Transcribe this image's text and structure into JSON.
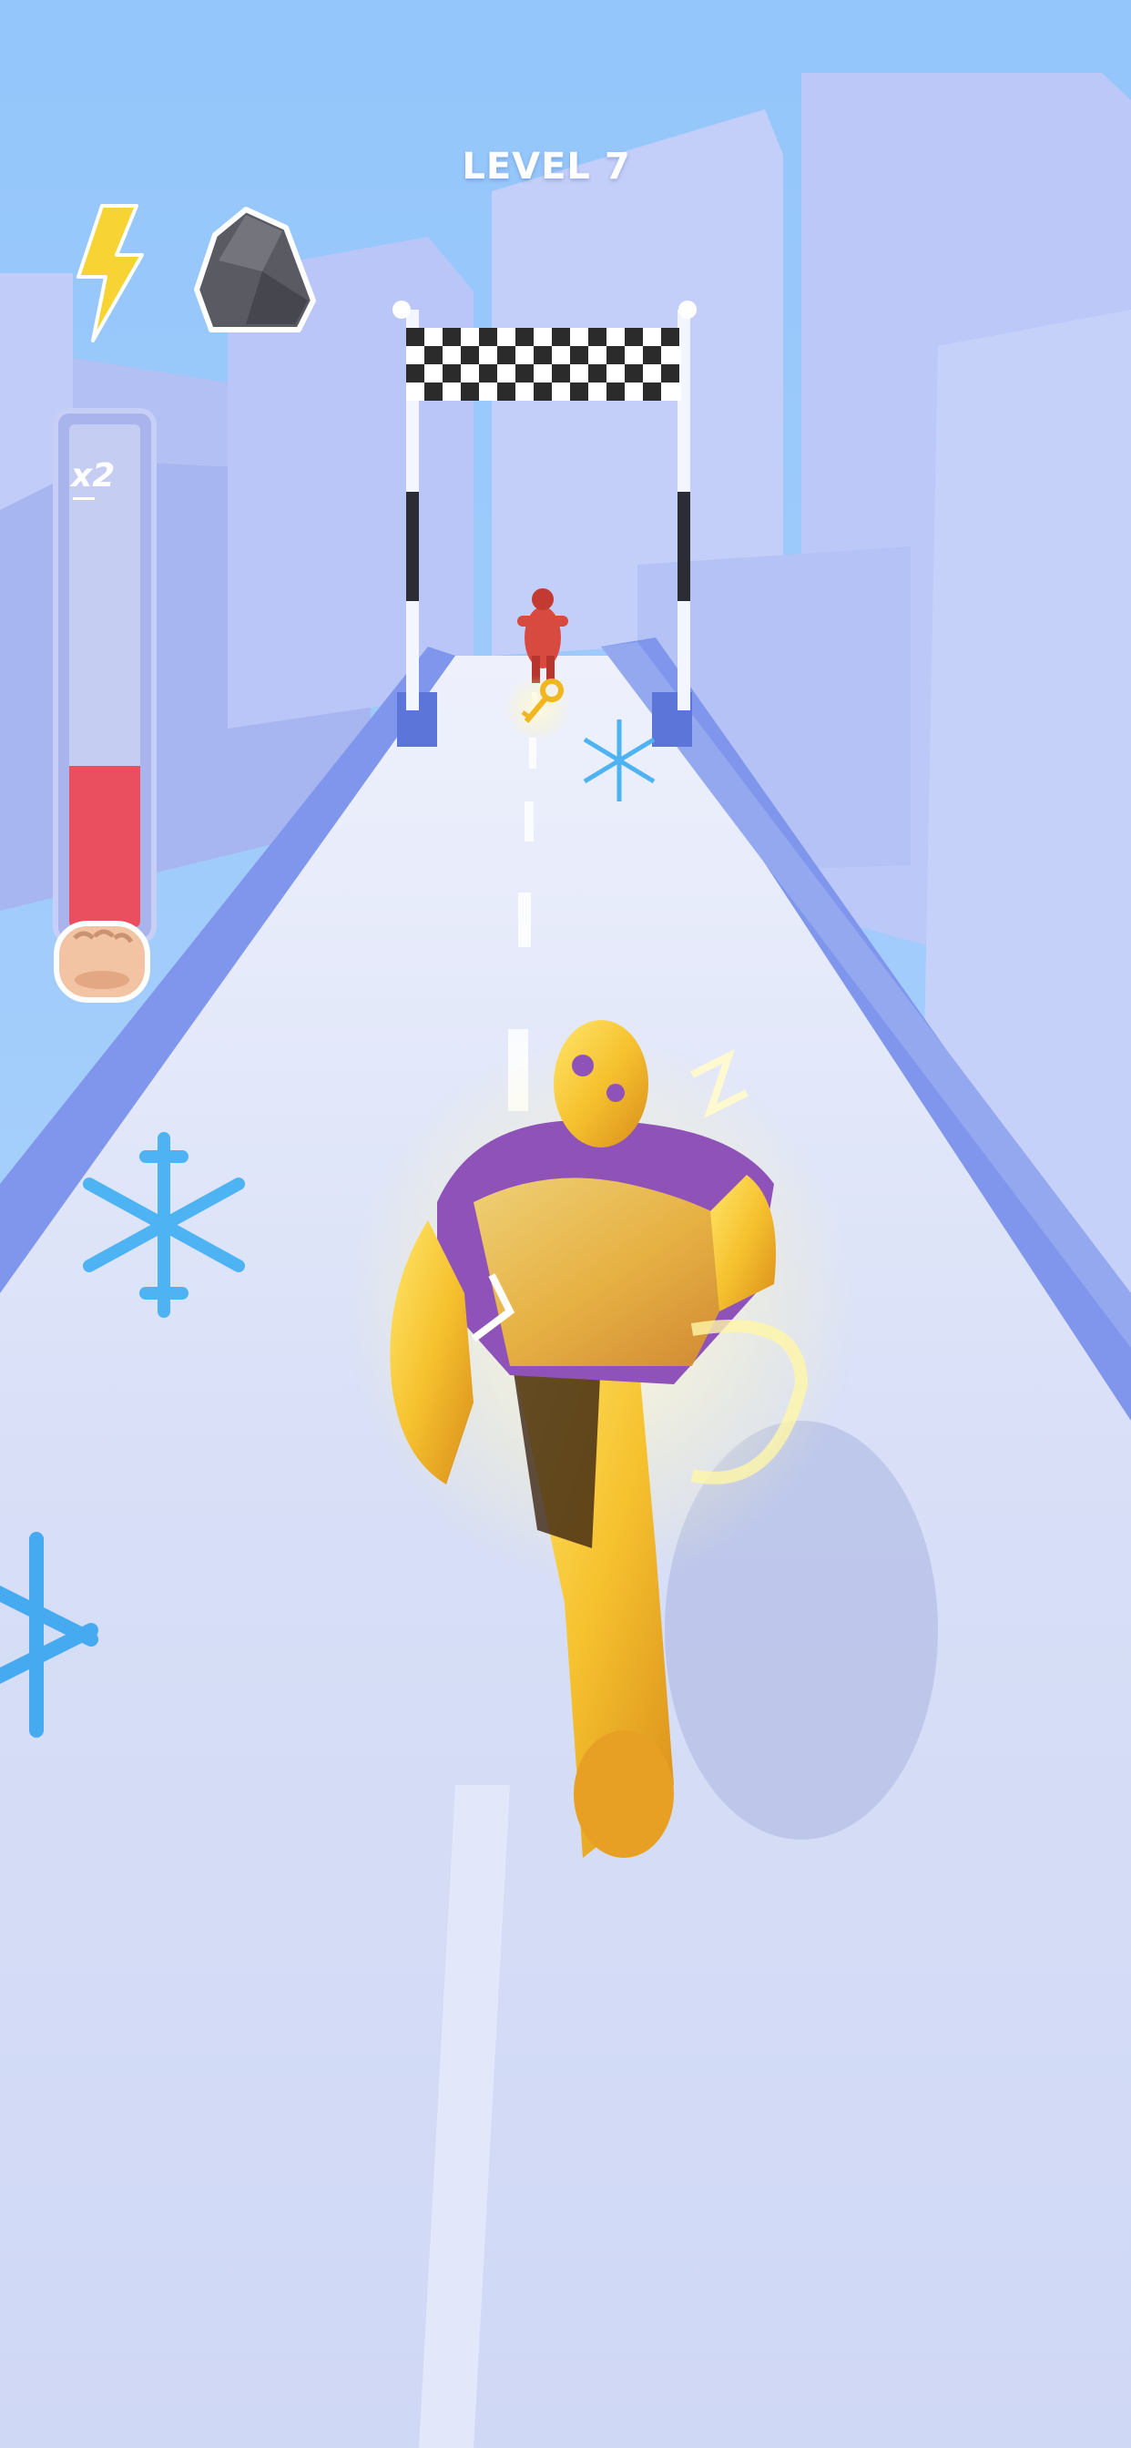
{
  "hud": {
    "level_label": "LEVEL 7",
    "powers": [
      {
        "name": "lightning",
        "icon": "lightning-icon",
        "color": "#f7d433"
      },
      {
        "name": "rock",
        "icon": "rock-icon",
        "color": "#5a5a63"
      }
    ],
    "meter": {
      "multiplier_label": "x2",
      "fill_fraction": 0.32,
      "fill_color": "#ea4f5f",
      "icon": "fist-icon"
    }
  },
  "colors": {
    "sky": "#9cc8f6",
    "road": "#d2dbf6",
    "rail": "#8ea2ee",
    "building": "#bcc8f8",
    "snowflake": "#4db3f2"
  }
}
